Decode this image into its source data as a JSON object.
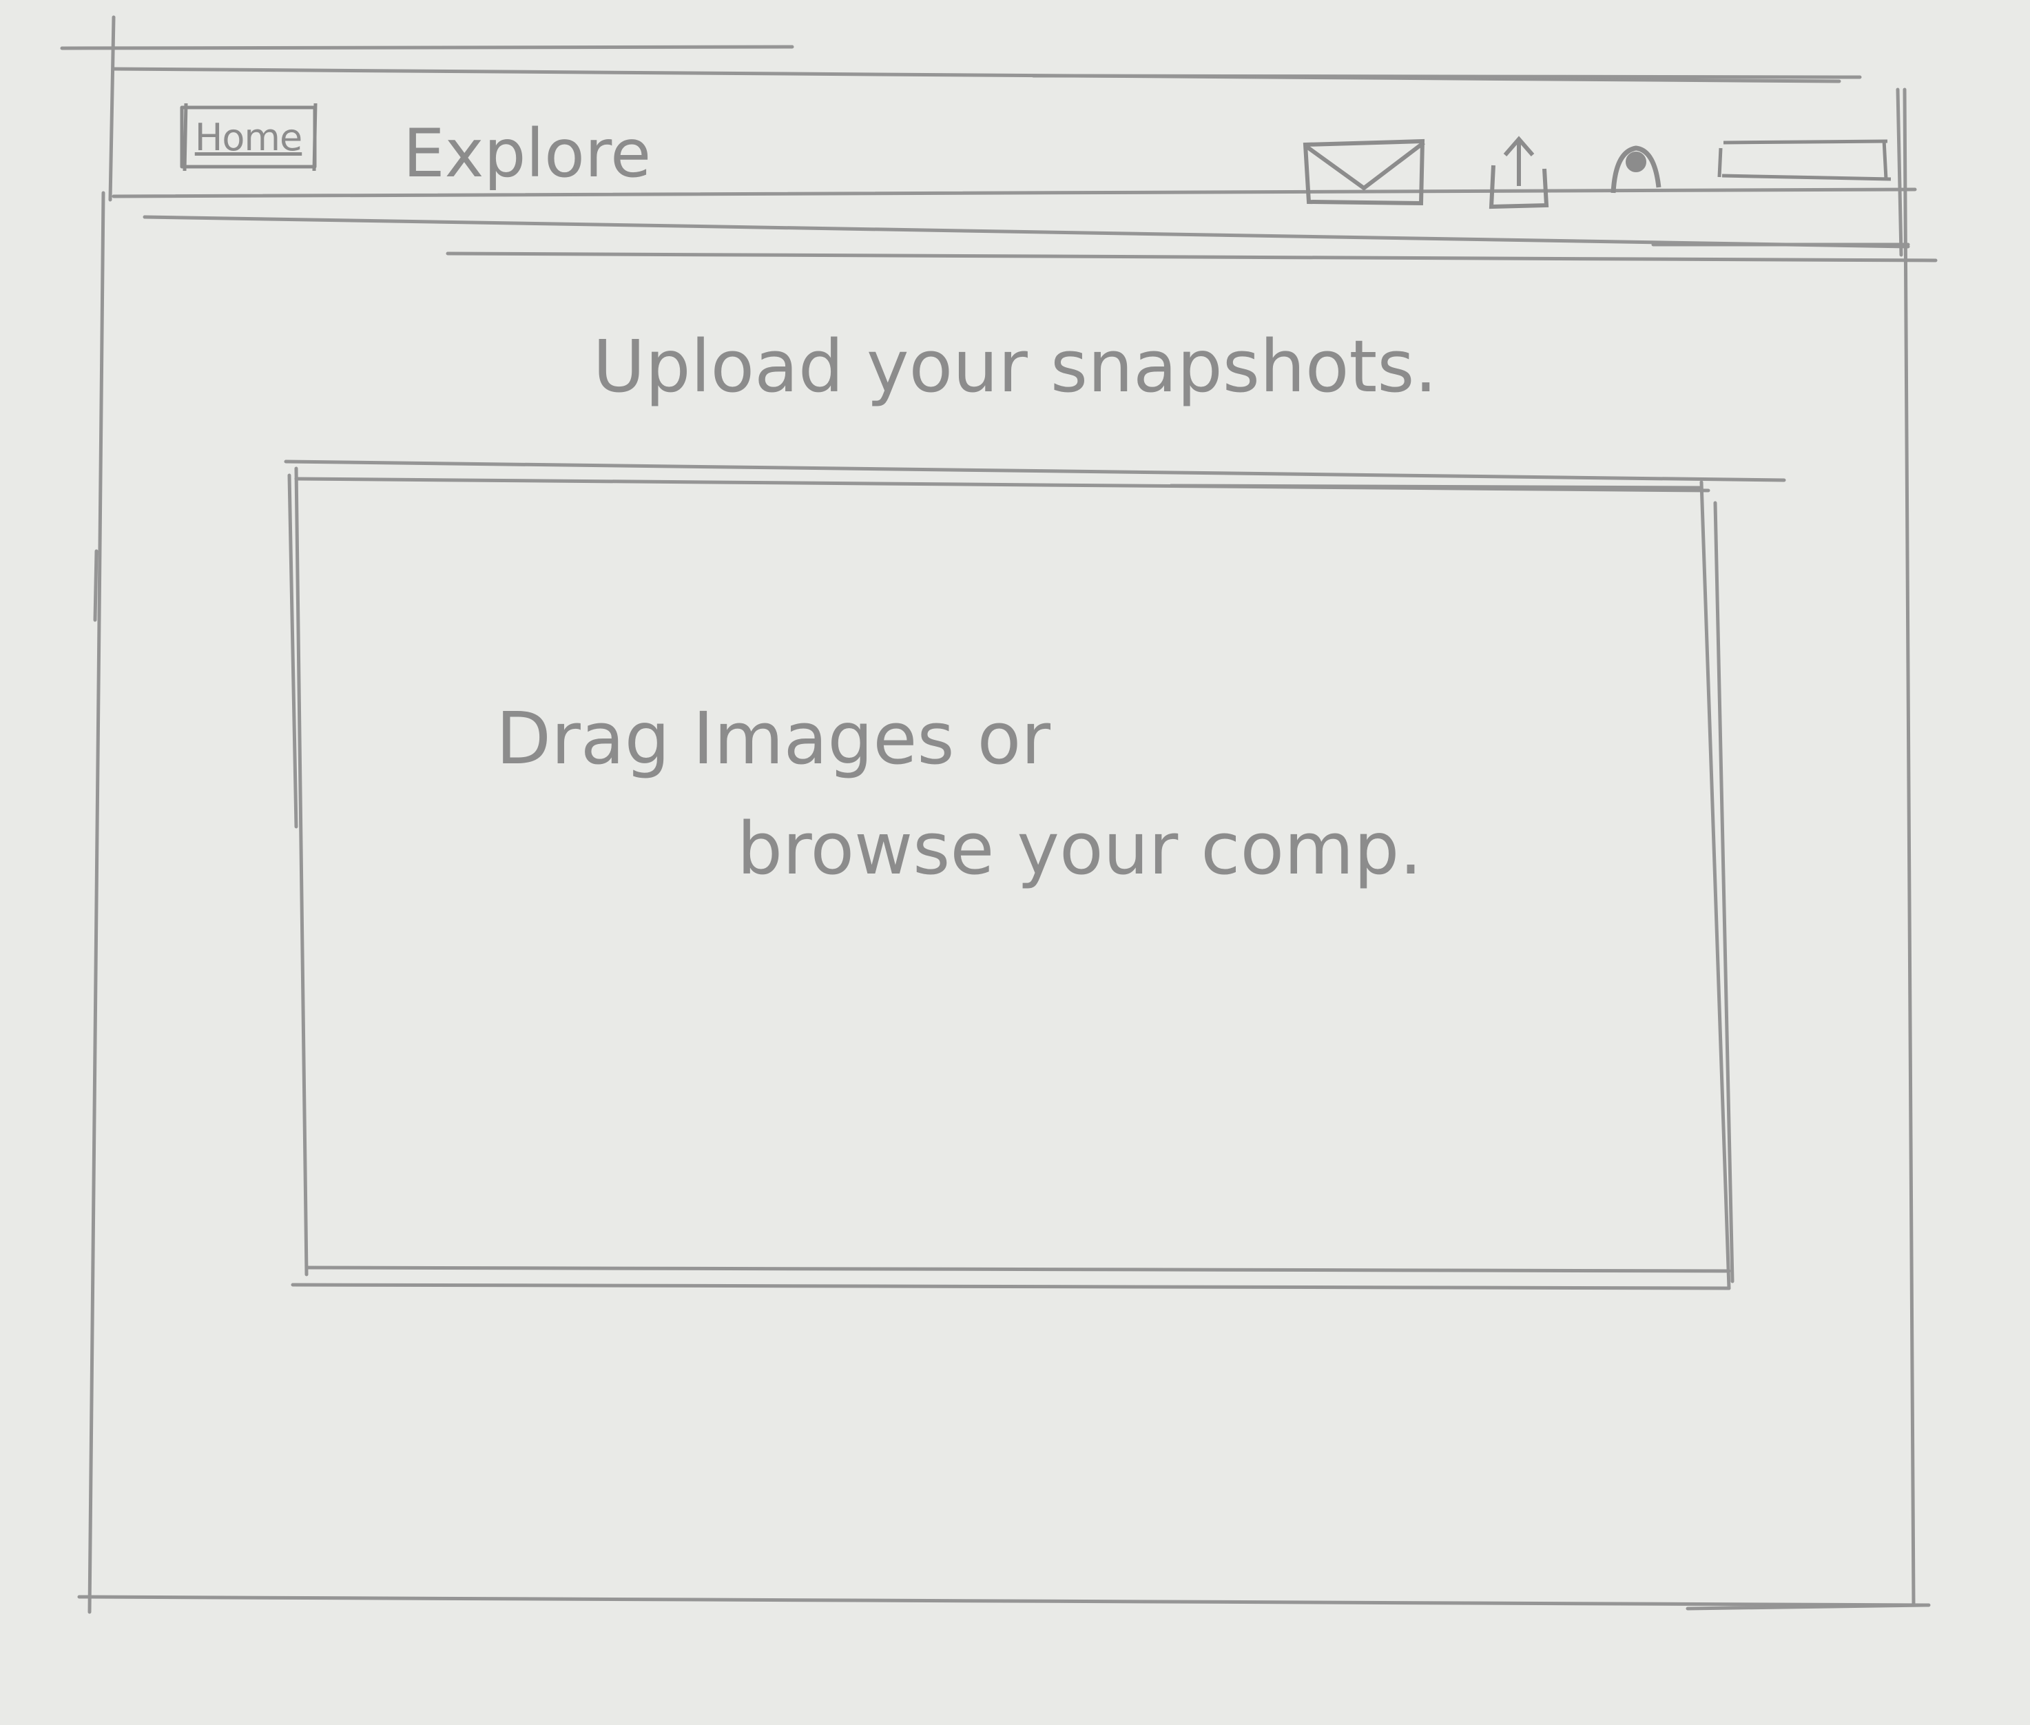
{
  "nav": {
    "home_label": "Home",
    "explore_label": "Explore"
  },
  "icons": {
    "mail": "envelope-icon",
    "upload": "upload-icon",
    "user": "user-icon"
  },
  "main": {
    "title": "Upload your snapshots.",
    "dropzone": {
      "line1": "Drag Images or",
      "line2": "browse your comp."
    }
  },
  "colors": {
    "paper": "#e9eae7",
    "pencil": "#959595"
  }
}
